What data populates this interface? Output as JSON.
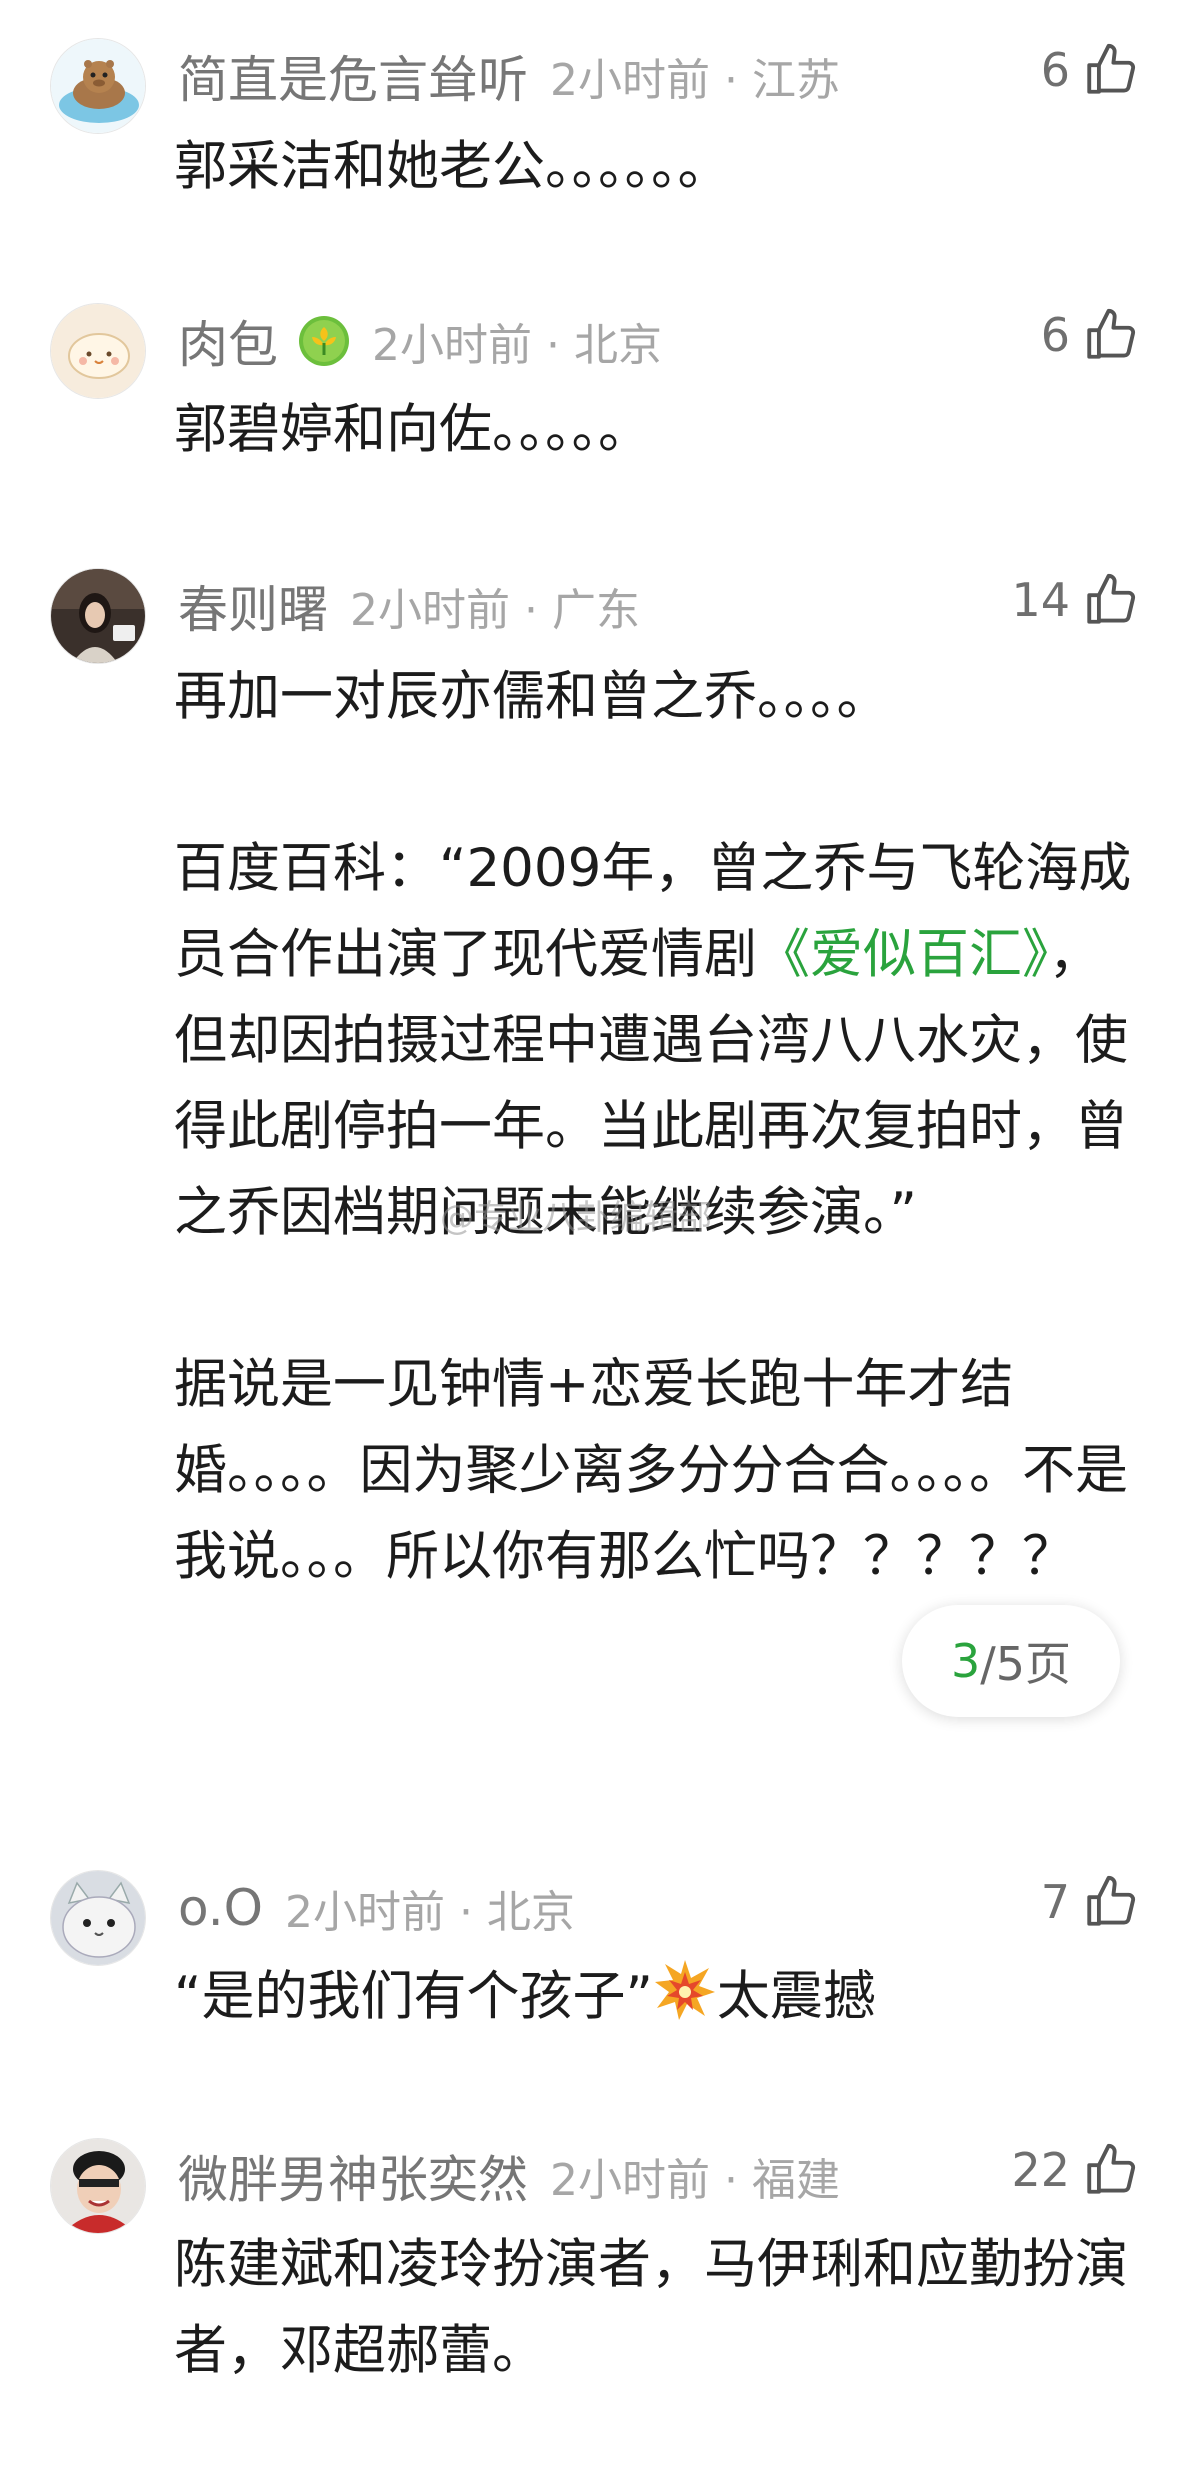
{
  "comments": [
    {
      "username": "简直是危言耸听",
      "time_location": "2小时前 · 江苏",
      "likes": "6",
      "avatar_icon": "capybara-avatar-icon",
      "paragraphs": [
        "郭采洁和她老公。。。。。。"
      ]
    },
    {
      "username": "肉包",
      "time_location": "2小时前 · 北京",
      "likes": "6",
      "avatar_icon": "bun-avatar-icon",
      "badge_icon": "flower-badge-icon",
      "paragraphs": [
        "郭碧婷和向佐。。。。。"
      ]
    },
    {
      "username": "春则曙",
      "time_location": "2小时前 · 广东",
      "likes": "14",
      "avatar_icon": "photo-avatar-icon",
      "paragraphs": [
        "再加一对辰亦儒和曾之乔。。。。",
        "百度百科：“2009年，曾之乔与飞轮海成员合作出演了现代爱情剧",
        "《爱似百汇》",
        "，但却因拍摄过程中遭遇台湾八八水灾，使得此剧停拍一年。当此剧再次复拍时，曾之乔因档期问题未能继续参演。”",
        "据说是一见钟情+恋爱长跑十年才结婚。。。。因为聚少离多分分合合。。。。不是我说。。。所以你有那么忙吗？？？？？"
      ]
    },
    {
      "username": "o.O",
      "time_location": "2小时前 · 北京",
      "likes": "7",
      "avatar_icon": "cat-avatar-icon",
      "text_before": "“是的我们有个孩子”",
      "emoji_icon": "collision-emoji-icon",
      "text_after": "太震撼"
    },
    {
      "username": "微胖男神张奕然",
      "time_location": "2小时前 · 福建",
      "likes": "22",
      "avatar_icon": "selfie-avatar-icon",
      "paragraphs": [
        "陈建斌和凌玲扮演者，马伊琍和应勤扮演者，邓超郝蕾。"
      ]
    }
  ],
  "pager": {
    "current": "3",
    "total_text": "/5页"
  },
  "watermark": "@专业八卦编辑部",
  "colors": {
    "link": "#2aa33d",
    "meta": "#a6a6a6",
    "username": "#767676"
  }
}
